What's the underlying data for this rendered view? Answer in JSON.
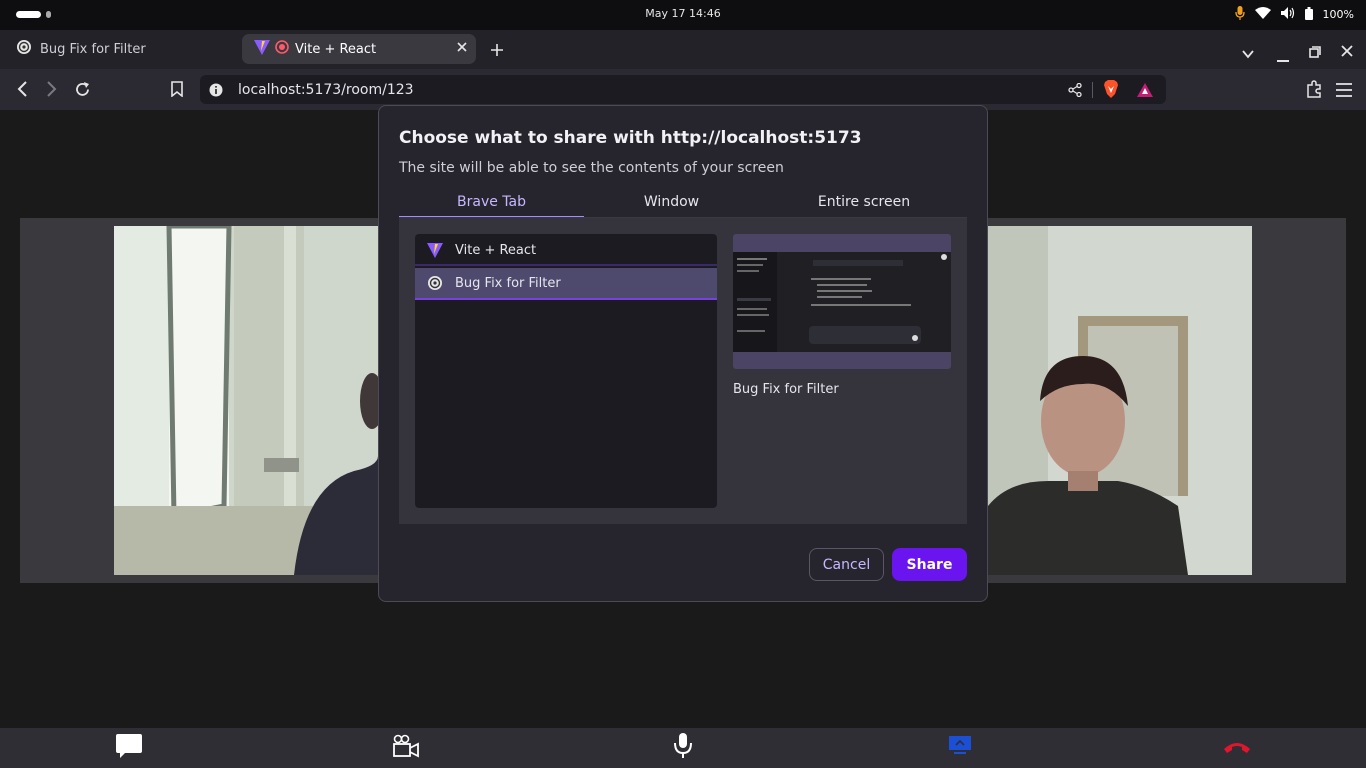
{
  "system": {
    "datetime": "May 17  14:46",
    "battery": "100%"
  },
  "tabs": [
    {
      "label": "Bug Fix for Filter"
    },
    {
      "label": "Vite + React"
    }
  ],
  "toolbar": {
    "url": "localhost:5173/room/123"
  },
  "dialog": {
    "title": "Choose what to share with http://localhost:5173",
    "subtitle": "The site will be able to see the contents of your screen",
    "tabs": [
      "Brave Tab",
      "Window",
      "Entire screen"
    ],
    "selected_tab": "Brave Tab",
    "list": [
      {
        "label": "Vite + React",
        "icon": "vite-icon"
      },
      {
        "label": "Bug Fix for Filter",
        "icon": "openai-icon",
        "selected": true
      }
    ],
    "preview_caption": "Bug Fix for Filter",
    "cancel_label": "Cancel",
    "share_label": "Share"
  },
  "colors": {
    "accent": "#6a14f0",
    "selected_tab_text": "#c7b7ff",
    "end_call": "#e0152e",
    "screen_share": "#1a4fd6"
  },
  "bottombar": {
    "icons": [
      "chat-icon",
      "camera-icon",
      "microphone-icon",
      "screen-share-icon",
      "end-call-icon"
    ]
  }
}
